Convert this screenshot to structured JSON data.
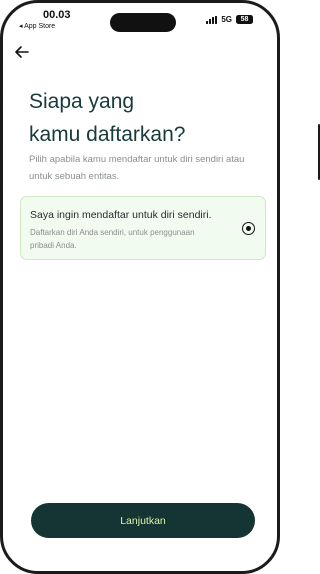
{
  "status_bar": {
    "time": "00.03",
    "back_app_label": "◂ App Store",
    "network": "5G",
    "battery": "58"
  },
  "nav": {
    "back_icon": "arrow-left-icon"
  },
  "heading": {
    "line1": "Siapa yang",
    "line2": "kamu daftarkan?"
  },
  "subtitle": "Pilih apabila kamu mendaftar untuk diri sendiri atau untuk sebuah entitas.",
  "option": {
    "title": "Saya ingin mendaftar untuk diri sendiri.",
    "description": "Daftarkan diri Anda sendiri, untuk penggunaan pribadi Anda.",
    "selected": true
  },
  "cta": {
    "label": "Lanjutkan"
  },
  "colors": {
    "primary": "#143534",
    "cta_text": "#dff3a8",
    "card_bg": "#f2fbf0",
    "card_border": "#cfe8c6",
    "heading": "#173a3a",
    "muted": "#8a8f8f"
  }
}
